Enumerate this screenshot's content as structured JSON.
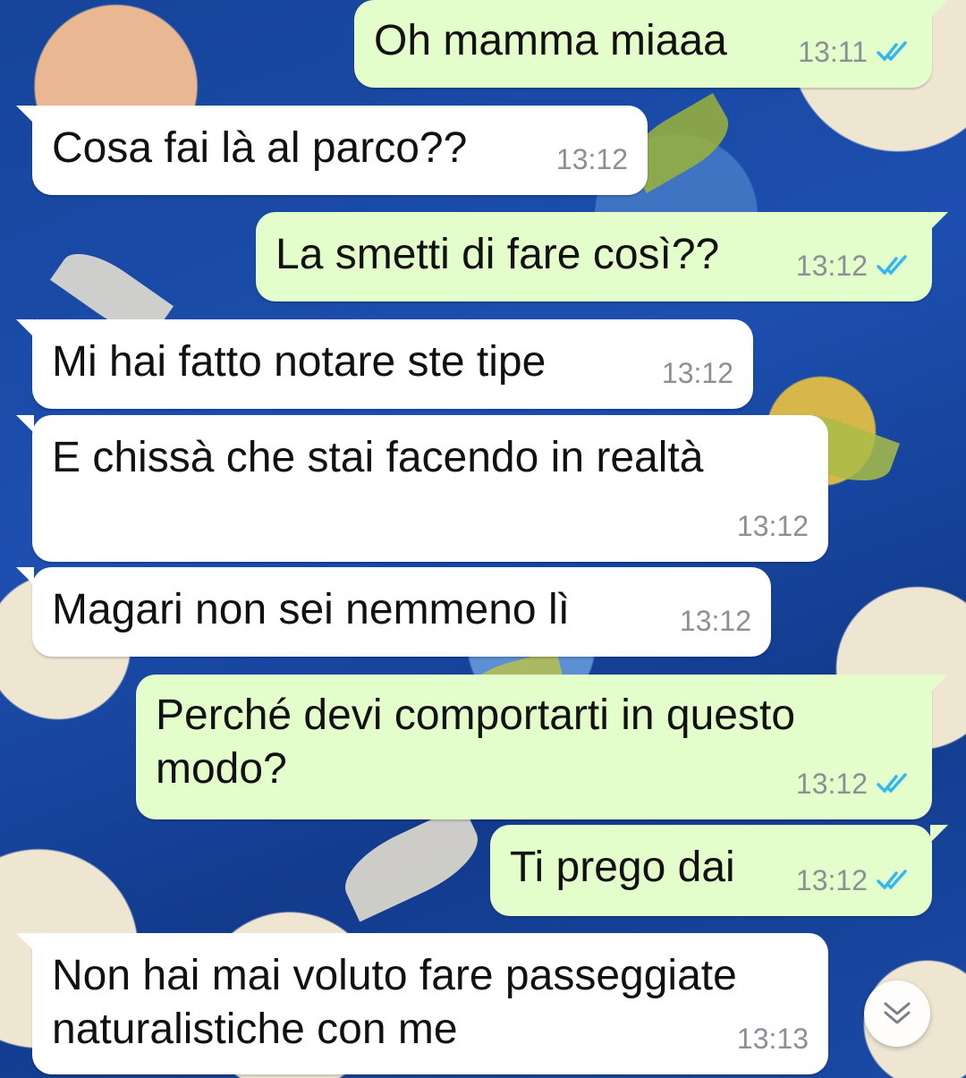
{
  "messages": [
    {
      "direction": "out",
      "text": "Oh mamma miaaa",
      "time": "13:11",
      "status": "read"
    },
    {
      "direction": "in",
      "text": "Cosa fai là al parco??",
      "time": "13:12"
    },
    {
      "direction": "out",
      "text": "La smetti di fare così??",
      "time": "13:12",
      "status": "read"
    },
    {
      "direction": "in",
      "text": "Mi hai fatto notare ste tipe",
      "time": "13:12"
    },
    {
      "direction": "in",
      "text": "E chissà che stai facendo in realtà",
      "time": "13:12"
    },
    {
      "direction": "in",
      "text": "Magari non sei nemmeno lì",
      "time": "13:12"
    },
    {
      "direction": "out",
      "text": "Perché devi comportarti in questo\nmodo?",
      "time": "13:12",
      "status": "read"
    },
    {
      "direction": "out",
      "text": "Ti prego dai",
      "time": "13:12",
      "status": "read"
    },
    {
      "direction": "in",
      "text": "Non hai mai voluto fare passeggiate\nnaturalistiche con me",
      "time": "13:13"
    }
  ],
  "scroll_button": {
    "icon": "double-chevron-down-icon"
  },
  "colors": {
    "incoming_bubble": "#ffffff",
    "outgoing_bubble": "#e3fdcb",
    "timestamp": "#8a9096",
    "read_ticks": "#34b7f1"
  }
}
